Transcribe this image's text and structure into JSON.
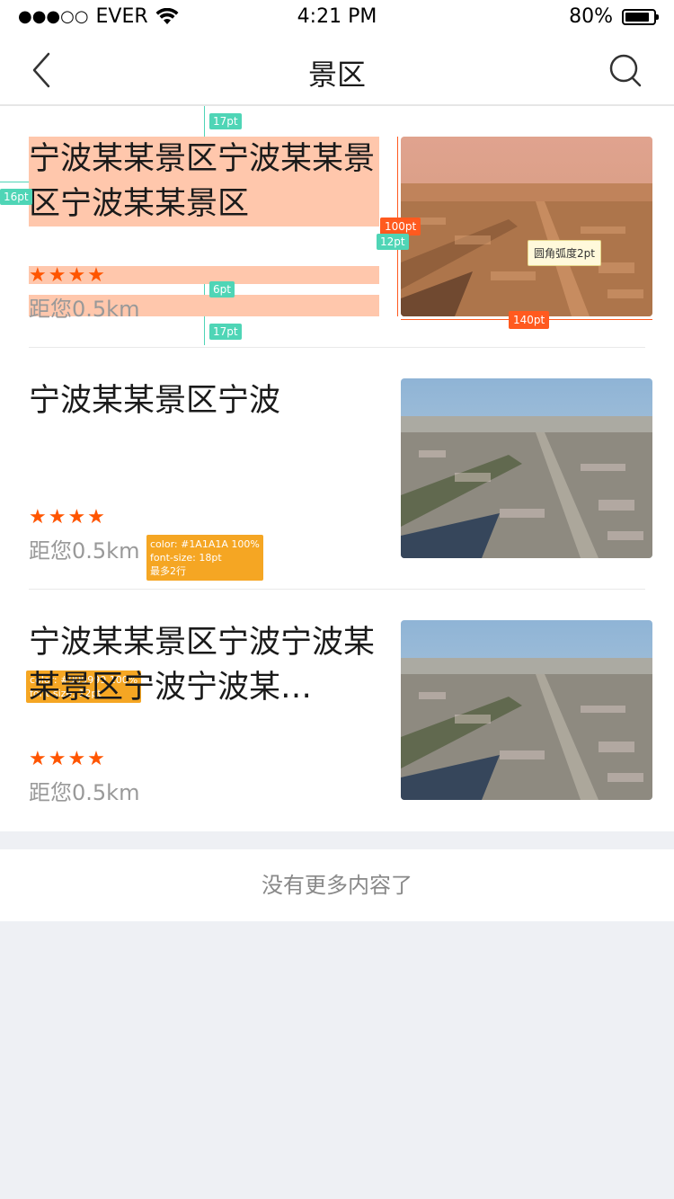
{
  "status": {
    "signal_dots": "●●●○○",
    "carrier": "EVER",
    "time": "4:21 PM",
    "battery": "80%"
  },
  "nav": {
    "title": "景区"
  },
  "items": [
    {
      "title": "宁波某某景区宁波某某景区宁波某某景区",
      "stars": "★★★★",
      "distance": "距您0.5km"
    },
    {
      "title": "宁波某某景区宁波",
      "stars": "★★★★",
      "distance": "距您0.5km"
    },
    {
      "title": "宁波某某景区宁波宁波某某景区宁波宁波某…",
      "stars": "★★★★",
      "distance": "距您0.5km"
    }
  ],
  "annotations": {
    "gap_top": "17pt",
    "gap_left": "16pt",
    "gap_mid": "6pt",
    "gap_bottom": "17pt",
    "gap_right": "12pt",
    "img_height": "100pt",
    "img_width": "140pt",
    "radius_note": "圆角弧度2pt",
    "title_spec": [
      "color: #1A1A1A 100%",
      "font-size: 18pt",
      "最多2行"
    ],
    "distance_spec": [
      "color: #999999 100%",
      "font-size: 12pt"
    ]
  },
  "footer": {
    "text": "没有更多内容了"
  },
  "colors": {
    "star": "#ff5500",
    "title": "#1A1A1A",
    "distance": "#999999",
    "annotation_teal": "#4fd5b6",
    "annotation_orange": "#ff5a1f",
    "annotation_yellow": "#f5a623"
  }
}
